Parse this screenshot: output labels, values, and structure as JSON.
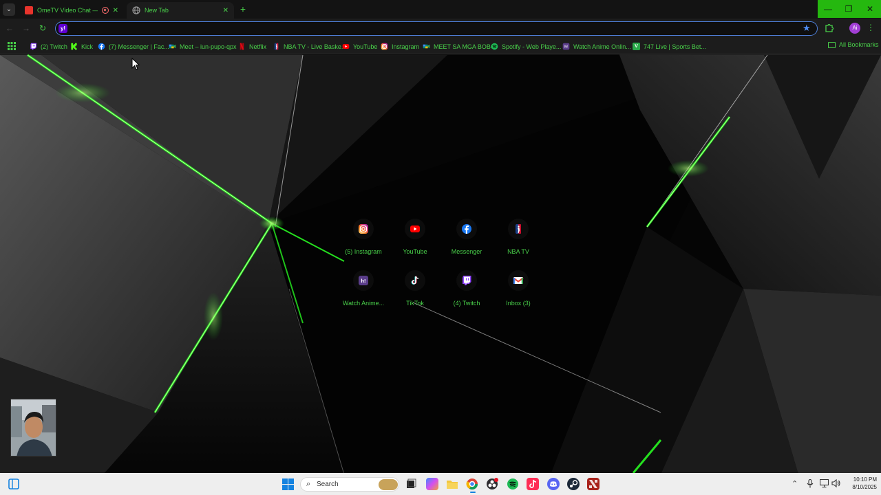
{
  "browser": {
    "tabs": [
      {
        "title": "OmeTV Video Chat — Ome",
        "active": false,
        "recording": true
      },
      {
        "title": "New Tab",
        "active": true,
        "recording": false
      }
    ],
    "new_tab_symbol": "+",
    "omnibox": {
      "value": "",
      "placeholder": "",
      "engine_icon_text": "y!"
    },
    "profile_initials": "Ai",
    "accent_color": "#49d04a",
    "window_controls_color": "#25b80f"
  },
  "bookmarks": {
    "items": [
      {
        "label": "(2) Twitch",
        "icon": "twitch-icon",
        "color": "#9146ff",
        "glyph": ""
      },
      {
        "label": "Kick",
        "icon": "kick-icon",
        "color": "#53fc18",
        "glyph": "K"
      },
      {
        "label": "(7) Messenger | Fac...",
        "icon": "facebook-icon",
        "color": "#1877f2",
        "glyph": "f"
      },
      {
        "label": "Meet – iun-pupo-qpx",
        "icon": "google-meet-icon",
        "color": "#00897b",
        "glyph": ""
      },
      {
        "label": "Netflix",
        "icon": "netflix-icon",
        "color": "#e50914",
        "glyph": "N"
      },
      {
        "label": "NBA TV - Live Baske...",
        "icon": "nba-icon",
        "color": "#c9082a",
        "glyph": ""
      },
      {
        "label": "YouTube",
        "icon": "youtube-icon",
        "color": "#ff0000",
        "glyph": "▶"
      },
      {
        "label": "Instagram",
        "icon": "instagram-icon",
        "color": "#d62976",
        "glyph": ""
      },
      {
        "label": "MEET SA MGA BOBO",
        "icon": "google-meet-icon",
        "color": "#00897b",
        "glyph": ""
      },
      {
        "label": "Spotify - Web Playe...",
        "icon": "spotify-icon",
        "color": "#1db954",
        "glyph": ""
      },
      {
        "label": "Watch Anime Onlin...",
        "icon": "hianime-icon",
        "color": "#5a3d8a",
        "glyph": "h!"
      },
      {
        "label": "747 Live | Sports Bet...",
        "icon": "747-live-icon",
        "color": "#2aa84a",
        "glyph": "V"
      }
    ],
    "all_bookmarks_label": "All Bookmarks"
  },
  "shortcuts": [
    {
      "label": "(5) Instagram",
      "icon": "instagram-icon"
    },
    {
      "label": "YouTube",
      "icon": "youtube-icon"
    },
    {
      "label": "Messenger",
      "icon": "facebook-icon"
    },
    {
      "label": "NBA TV",
      "icon": "nba-icon"
    },
    {
      "label": "Watch Anime...",
      "icon": "hianime-icon"
    },
    {
      "label": "TikTok",
      "icon": "tiktok-icon"
    },
    {
      "label": "(4) Twitch",
      "icon": "twitch-icon"
    },
    {
      "label": "Inbox (3)",
      "icon": "gmail-icon"
    }
  ],
  "taskbar": {
    "search_placeholder": "Search",
    "time": "10:10 PM",
    "date": "8/10/2025"
  }
}
